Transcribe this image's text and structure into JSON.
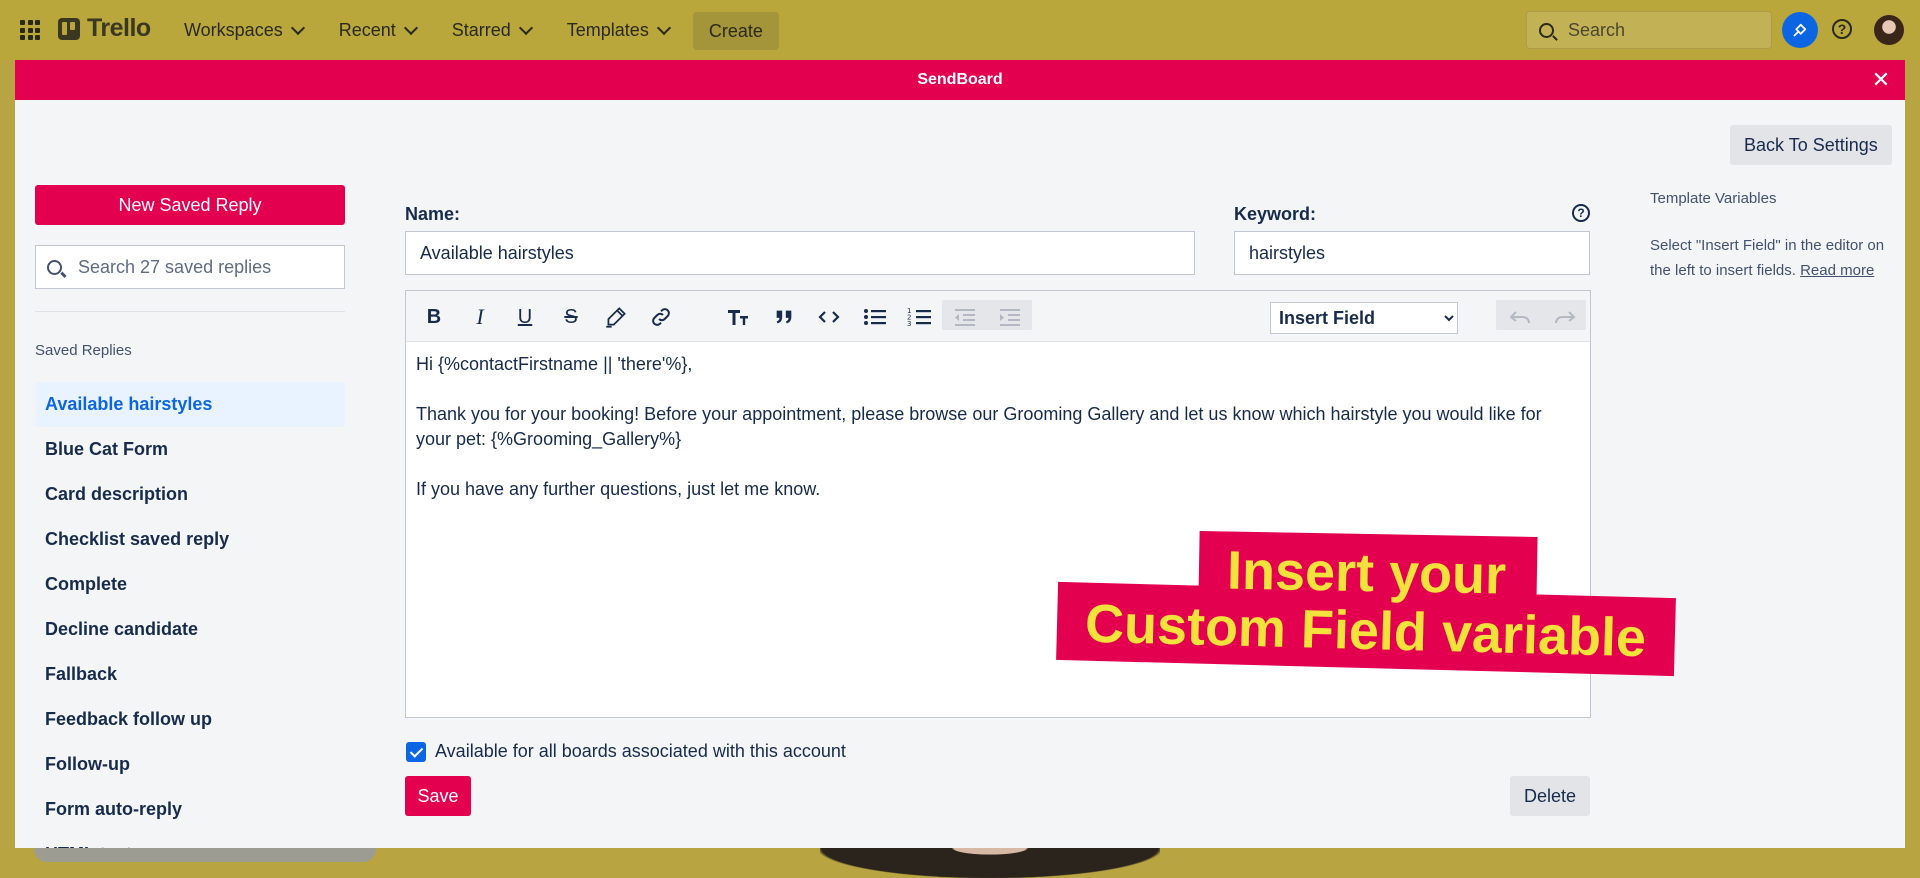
{
  "topbar": {
    "logo_text": "Trello",
    "nav": [
      "Workspaces",
      "Recent",
      "Starred",
      "Templates"
    ],
    "create_label": "Create",
    "search_placeholder": "Search"
  },
  "modal": {
    "title": "SendBoard",
    "close_glyph": "✕",
    "back_label": "Back To Settings"
  },
  "left": {
    "new_reply_label": "New Saved Reply",
    "search_placeholder": "Search 27 saved replies",
    "section_label": "Saved Replies",
    "items": [
      "Available hairstyles",
      "Blue Cat Form",
      "Card description",
      "Checklist saved reply",
      "Complete",
      "Decline candidate",
      "Fallback",
      "Feedback follow up",
      "Follow-up",
      "Form auto-reply",
      "HTML test"
    ],
    "active_index": 0
  },
  "form": {
    "name_label": "Name:",
    "name_value": "Available hairstyles",
    "keyword_label": "Keyword:",
    "keyword_value": "hairstyles",
    "help_glyph": "?",
    "insert_field_label": "Insert Field",
    "body_lines": [
      "Hi {%contactFirstname || 'there'%},",
      "Thank you for your booking! Before your appointment, please browse our Grooming Gallery and let us know which hairstyle you would like for your pet:  {%Grooming_Gallery%}",
      "If you have any further questions, just let me know."
    ],
    "checkbox_label": "Available for all boards associated with this account",
    "checkbox_checked": true,
    "save_label": "Save",
    "delete_label": "Delete"
  },
  "promo": {
    "line1": "Insert your",
    "line2": "Custom Field variable"
  },
  "template_variables": {
    "title": "Template Variables",
    "text": "Select \"Insert Field\" in the editor on the left to insert fields.",
    "link": "Read more"
  },
  "colors": {
    "accent": "#e3004f",
    "topbar": "#b9a73b",
    "active_item": "#0c66e4",
    "promo_text": "#f4e23c"
  }
}
